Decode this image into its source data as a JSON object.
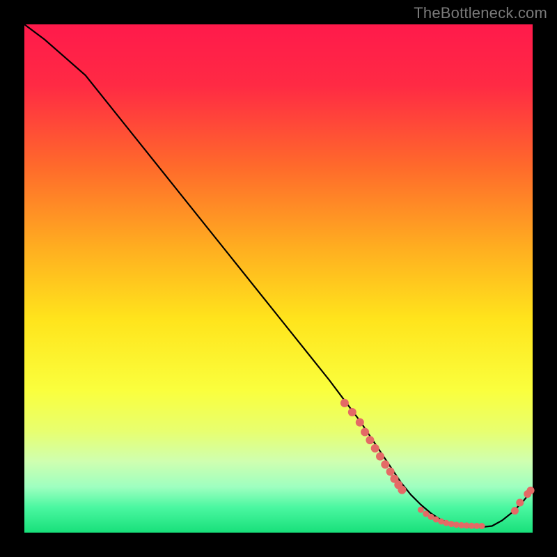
{
  "watermark": "TheBottleneck.com",
  "gradient_stops": [
    {
      "offset": 0.0,
      "color": "#ff1a4b"
    },
    {
      "offset": 0.12,
      "color": "#ff2a44"
    },
    {
      "offset": 0.28,
      "color": "#ff6a2b"
    },
    {
      "offset": 0.44,
      "color": "#ffae20"
    },
    {
      "offset": 0.58,
      "color": "#ffe41c"
    },
    {
      "offset": 0.72,
      "color": "#faff3d"
    },
    {
      "offset": 0.8,
      "color": "#e8ff6f"
    },
    {
      "offset": 0.86,
      "color": "#cfffb0"
    },
    {
      "offset": 0.91,
      "color": "#9effc0"
    },
    {
      "offset": 0.95,
      "color": "#4bf7a1"
    },
    {
      "offset": 1.0,
      "color": "#18e07a"
    }
  ],
  "chart_data": {
    "type": "line",
    "title": "",
    "xlabel": "",
    "ylabel": "",
    "xlim": [
      0,
      100
    ],
    "ylim": [
      0,
      100
    ],
    "series": [
      {
        "name": "curve",
        "color": "#000000",
        "x": [
          0,
          4,
          8,
          12,
          20,
          30,
          40,
          50,
          60,
          66,
          68,
          70,
          72,
          74,
          76,
          78,
          80,
          82,
          84,
          86,
          88,
          90,
          92,
          94,
          96,
          98,
          100
        ],
        "y": [
          100,
          97,
          93.5,
          90,
          80,
          67.5,
          55,
          42.5,
          30,
          22,
          19,
          16,
          13,
          10,
          7.5,
          5.5,
          3.8,
          2.5,
          1.8,
          1.3,
          1.1,
          1.1,
          1.3,
          2.4,
          4.0,
          6.0,
          8.5
        ]
      }
    ],
    "markers": [
      {
        "name": "dots-descent",
        "color": "#e46a66",
        "radius": 6,
        "points": [
          [
            63,
            25.5
          ],
          [
            64.5,
            23.7
          ],
          [
            66,
            21.7
          ],
          [
            67,
            19.8
          ],
          [
            68,
            18.2
          ],
          [
            69,
            16.6
          ],
          [
            70,
            15.0
          ],
          [
            71,
            13.4
          ],
          [
            72,
            12.0
          ],
          [
            72.8,
            10.6
          ],
          [
            73.6,
            9.4
          ],
          [
            74.3,
            8.4
          ]
        ]
      },
      {
        "name": "dots-trough",
        "color": "#e46a66",
        "radius": 4.5,
        "points": [
          [
            78,
            4.5
          ],
          [
            79,
            3.7
          ],
          [
            80,
            3.1
          ],
          [
            81,
            2.6
          ],
          [
            82,
            2.2
          ],
          [
            83,
            1.9
          ],
          [
            84,
            1.7
          ],
          [
            85,
            1.55
          ],
          [
            86,
            1.45
          ],
          [
            87,
            1.4
          ],
          [
            88,
            1.35
          ],
          [
            89,
            1.32
          ],
          [
            90,
            1.3
          ]
        ]
      },
      {
        "name": "dots-uptick",
        "color": "#e46a66",
        "radius": 5.5,
        "points": [
          [
            96.5,
            4.3
          ],
          [
            97.5,
            5.9
          ],
          [
            99.0,
            7.6
          ],
          [
            99.6,
            8.3
          ]
        ]
      }
    ]
  }
}
